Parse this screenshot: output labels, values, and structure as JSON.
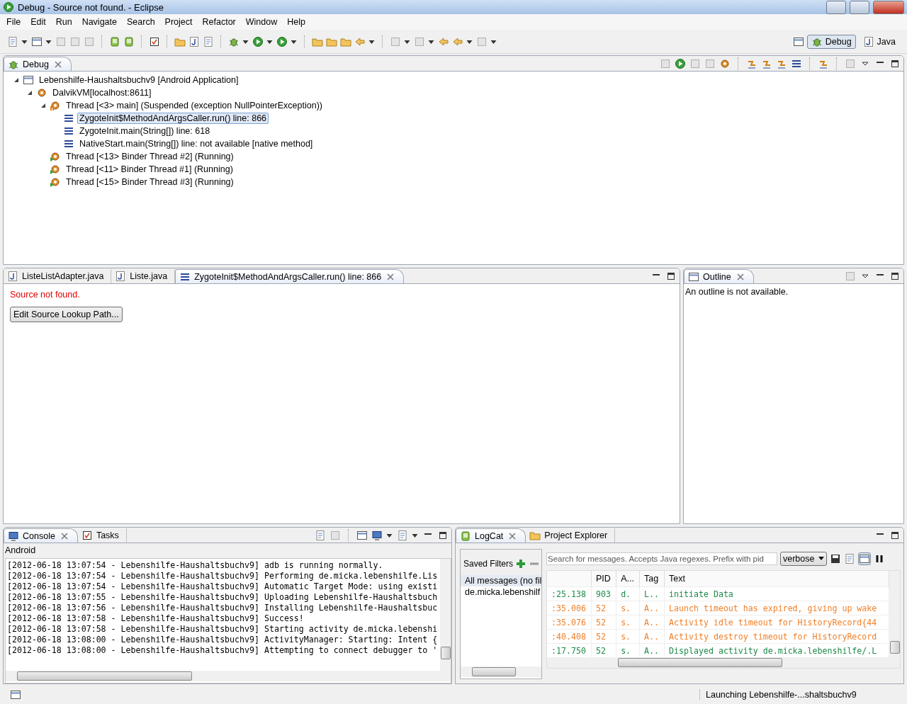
{
  "window": {
    "title": "Debug - Source not found. - Eclipse"
  },
  "menu": [
    "File",
    "Edit",
    "Run",
    "Navigate",
    "Search",
    "Project",
    "Refactor",
    "Window",
    "Help"
  ],
  "perspectives": [
    {
      "label": "Debug",
      "selected": true
    },
    {
      "label": "Java",
      "selected": false
    }
  ],
  "debug_view": {
    "tab": "Debug",
    "tree": [
      {
        "kind": "target",
        "label": "Lebenshilfe-Haushaltsbuchv9 [Android Application]",
        "selected": false,
        "expanded": true,
        "children": [
          {
            "kind": "vm",
            "label": "DalvikVM[localhost:8611]",
            "selected": false,
            "expanded": true,
            "children": [
              {
                "kind": "thread",
                "label": "Thread [<3> main] (Suspended (exception NullPointerException))",
                "suspended": true,
                "selected": false,
                "expanded": true,
                "children": [
                  {
                    "kind": "frame",
                    "label": "ZygoteInit$MethodAndArgsCaller.run() line: 866",
                    "selected": true
                  },
                  {
                    "kind": "frame",
                    "label": "ZygoteInit.main(String[]) line: 618",
                    "selected": false
                  },
                  {
                    "kind": "frame",
                    "label": "NativeStart.main(String[]) line: not available [native method]",
                    "selected": false
                  }
                ]
              },
              {
                "kind": "thread",
                "label": "Thread [<13> Binder Thread #2] (Running)",
                "suspended": false,
                "selected": false
              },
              {
                "kind": "thread",
                "label": "Thread [<11> Binder Thread #1] (Running)",
                "suspended": false,
                "selected": false
              },
              {
                "kind": "thread",
                "label": "Thread [<15> Binder Thread #3] (Running)",
                "suspended": false,
                "selected": false
              }
            ]
          }
        ]
      }
    ]
  },
  "editor": {
    "tabs": [
      {
        "kind": "java",
        "label": "ListeListAdapter.java",
        "selected": false
      },
      {
        "kind": "java",
        "label": "Liste.java",
        "selected": false
      },
      {
        "kind": "frame",
        "label": "ZygoteInit$MethodAndArgsCaller.run() line: 866",
        "selected": true
      }
    ],
    "error": "Source not found.",
    "button": "Edit Source Lookup Path..."
  },
  "outline": {
    "tab": "Outline",
    "message": "An outline is not available."
  },
  "console": {
    "tabs": [
      {
        "label": "Console",
        "selected": true
      },
      {
        "label": "Tasks",
        "selected": false
      }
    ],
    "name": "Android",
    "lines": [
      "[2012-06-18 13:07:54 - Lebenshilfe-Haushaltsbuchv9] adb is running normally.",
      "[2012-06-18 13:07:54 - Lebenshilfe-Haushaltsbuchv9] Performing de.micka.lebenshilfe.Lis",
      "[2012-06-18 13:07:54 - Lebenshilfe-Haushaltsbuchv9] Automatic Target Mode: using existi",
      "[2012-06-18 13:07:55 - Lebenshilfe-Haushaltsbuchv9] Uploading Lebenshilfe-Haushaltsbuch",
      "[2012-06-18 13:07:56 - Lebenshilfe-Haushaltsbuchv9] Installing Lebenshilfe-Haushaltsbuc",
      "[2012-06-18 13:07:58 - Lebenshilfe-Haushaltsbuchv9] Success!",
      "[2012-06-18 13:07:58 - Lebenshilfe-Haushaltsbuchv9] Starting activity de.micka.lebenshi",
      "[2012-06-18 13:08:00 - Lebenshilfe-Haushaltsbuchv9] ActivityManager: Starting: Intent {",
      "[2012-06-18 13:08:00 - Lebenshilfe-Haushaltsbuchv9] Attempting to connect debugger to '"
    ]
  },
  "logcat": {
    "tabs": [
      {
        "label": "LogCat",
        "selected": true
      },
      {
        "label": "Project Explorer",
        "selected": false
      }
    ],
    "saved_filters": {
      "title": "Saved Filters",
      "items": [
        {
          "label": "All messages (no fil",
          "selected": true
        },
        {
          "label": "de.micka.lebenshilf",
          "selected": false
        }
      ]
    },
    "search": {
      "placeholder": "Search for messages. Accepts Java regexes. Prefix with pid"
    },
    "level": "verbose",
    "columns": [
      "PID",
      "A...",
      "Tag",
      "Text"
    ],
    "rows": [
      {
        "time": ":25.138",
        "pid": "903",
        "app": "d.",
        "tag": "L..",
        "text": "initiate Data",
        "color": "#1e8a4a"
      },
      {
        "time": ":35.006",
        "pid": "52",
        "app": "s.",
        "tag": "A..",
        "text": "Launch timeout has expired, giving up wake",
        "color": "#f0802a"
      },
      {
        "time": ":35.076",
        "pid": "52",
        "app": "s.",
        "tag": "A..",
        "text": "Activity idle timeout for HistoryRecord{44",
        "color": "#f0802a"
      },
      {
        "time": ":40.408",
        "pid": "52",
        "app": "s.",
        "tag": "A..",
        "text": "Activity destroy timeout for HistoryRecord",
        "color": "#f0802a"
      },
      {
        "time": ":17.750",
        "pid": "52",
        "app": "s.",
        "tag": "A..",
        "text": "Displayed activity de.micka.lebenshilfe/.L",
        "color": "#1e8a4a"
      }
    ]
  },
  "status_bar": {
    "message": "Launching Lebenshilfe-...shaltsbuchv9"
  }
}
